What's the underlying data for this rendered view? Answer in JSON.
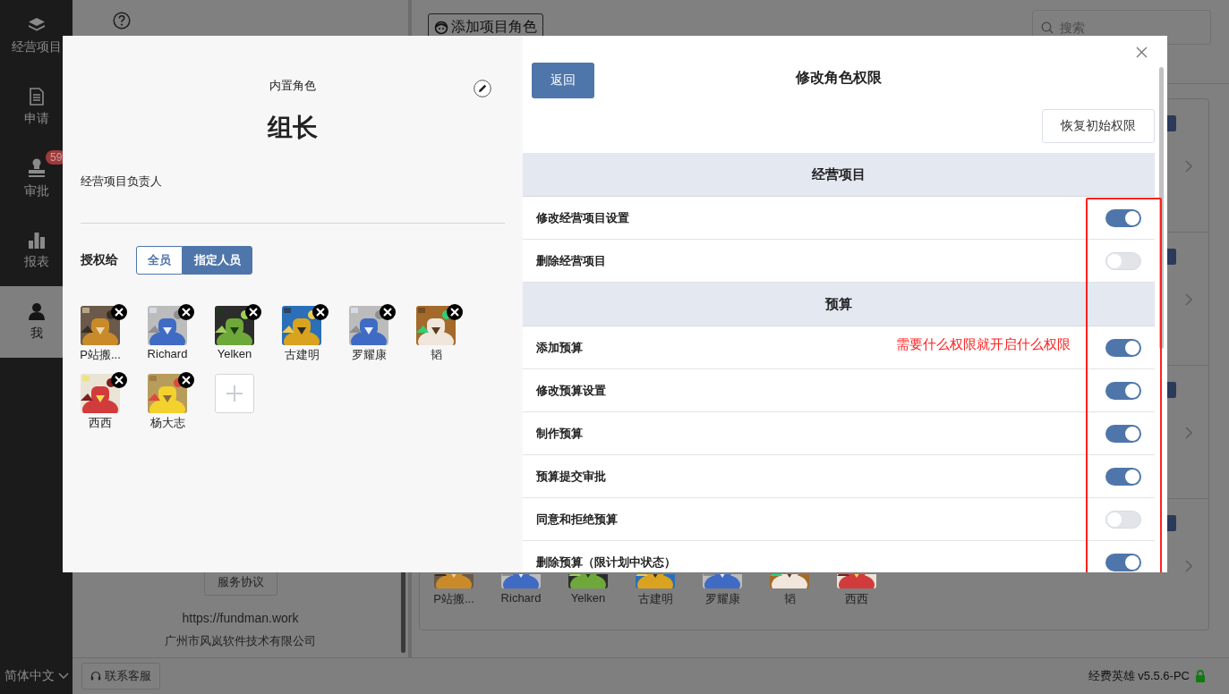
{
  "sidebar": {
    "items": [
      {
        "label": "经营项目",
        "selected": false
      },
      {
        "label": "申请",
        "selected": false
      },
      {
        "label": "审批",
        "selected": false,
        "badge": "59"
      },
      {
        "label": "报表",
        "selected": false
      },
      {
        "label": "我",
        "selected": true
      }
    ],
    "language": "简体中文"
  },
  "background": {
    "add_role_button": "添加项目角色",
    "search": {
      "placeholder": "搜索"
    },
    "member_names": [
      "P站搬...",
      "Richard",
      "Yelken",
      "古建明",
      "罗耀康",
      "韬",
      "西西"
    ],
    "service_button": "服务协议",
    "website": "https://fundman.work",
    "company": "广州市风岚软件技术有限公司"
  },
  "dialog": {
    "role_type": "内置角色",
    "role_name": "组长",
    "description": "经营项目负责人",
    "grant_label": "授权给",
    "grant_options": [
      {
        "label": "全员",
        "selected": false
      },
      {
        "label": "指定人员",
        "selected": true
      }
    ],
    "members": [
      {
        "name": "P站搬..."
      },
      {
        "name": "Richard"
      },
      {
        "name": "Yelken"
      },
      {
        "name": "古建明"
      },
      {
        "name": "罗耀康"
      },
      {
        "name": "韬"
      },
      {
        "name": "西西"
      },
      {
        "name": "杨大志"
      }
    ],
    "back_button": "返回",
    "title": "修改角色权限",
    "reset_button": "恢复初始权限",
    "sections": [
      {
        "title": "经营项目",
        "permissions": [
          {
            "label": "修改经营项目设置",
            "on": true
          },
          {
            "label": "删除经营项目",
            "on": false
          }
        ]
      },
      {
        "title": "预算",
        "permissions": [
          {
            "label": "添加预算",
            "on": true
          },
          {
            "label": "修改预算设置",
            "on": true
          },
          {
            "label": "制作预算",
            "on": true
          },
          {
            "label": "预算提交审批",
            "on": true
          },
          {
            "label": "同意和拒绝预算",
            "on": false
          },
          {
            "label": "删除预算（限计划中状态）",
            "on": true
          }
        ]
      }
    ],
    "annotation": "需要什么权限就开启什么权限"
  },
  "footer": {
    "support_button": "联系客服",
    "version": "经费英雄 v5.5.6-PC"
  }
}
